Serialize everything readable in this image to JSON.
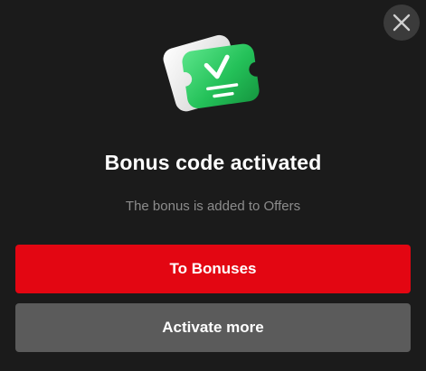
{
  "dialog": {
    "title": "Bonus code activated",
    "subtitle": "The bonus is added to Offers",
    "close_icon": "close-icon",
    "illustration_icon": "bonus-ticket-check-icon",
    "primary_button": "To Bonuses",
    "secondary_button": "Activate more"
  },
  "colors": {
    "background": "#1b1b1b",
    "primary": "#e30612",
    "secondary": "#5b5b5b",
    "ticket_green": "#27c05a"
  }
}
